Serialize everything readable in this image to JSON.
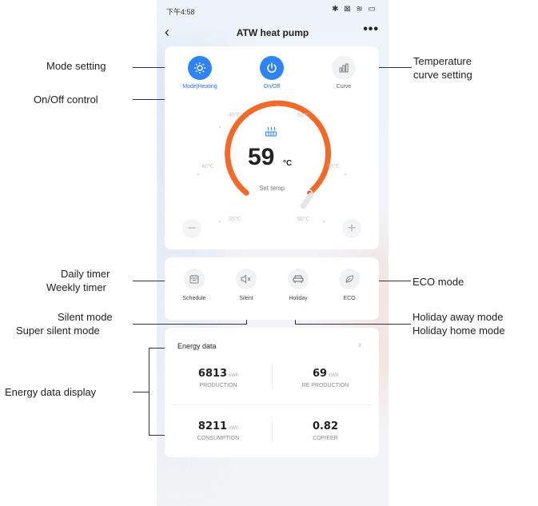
{
  "status_bar": {
    "time": "下午4:58",
    "icons": "✱ ⊠ ≋ ▭"
  },
  "nav": {
    "back_icon": "‹",
    "title": "ATW heat pump",
    "more_icon": "•••"
  },
  "top_controls": [
    {
      "label": "Mode|Heating",
      "icon": "sun-icon",
      "active": true
    },
    {
      "label": "On/Off",
      "icon": "power-icon",
      "active": true
    },
    {
      "label": "Curve",
      "icon": "bar-chart-icon",
      "active": false
    }
  ],
  "dial": {
    "set_value": "59",
    "unit": "°C",
    "caption": "Set temp",
    "ticks": [
      "35℃",
      "40℃",
      "45℃",
      "50℃",
      "55℃",
      "60℃"
    ],
    "arc_color": "#f06a2a",
    "decrease_label": "−",
    "increase_label": "+"
  },
  "mode_buttons": [
    {
      "label": "Schedule",
      "icon": "calendar-icon"
    },
    {
      "label": "Silent",
      "icon": "speaker-mute-icon"
    },
    {
      "label": "Holiday",
      "icon": "sofa-icon"
    },
    {
      "label": "ECO",
      "icon": "leaf-icon"
    }
  ],
  "energy": {
    "title": "Energy data",
    "arrow": "›",
    "cells": [
      {
        "value": "6813",
        "unit": "kWh",
        "label": "PRODUCTION"
      },
      {
        "value": "69",
        "unit": "kWh",
        "label": "RE PRODUCTION"
      },
      {
        "value": "8211",
        "unit": "kWh",
        "label": "CONSUMPTION"
      },
      {
        "value": "0.82",
        "unit": "",
        "label": "COP/EER"
      }
    ]
  },
  "annotations": {
    "mode_setting": "Mode setting",
    "onoff_control": "On/Off control",
    "temp_curve_1": "Temperature",
    "temp_curve_2": "curve setting",
    "daily_timer": "Daily timer",
    "weekly_timer": "Weekly timer",
    "silent_mode": "Silent mode",
    "super_silent_mode": "Super silent mode",
    "energy_display": "Energy data display",
    "eco_mode": "ECO mode",
    "holiday_away": "Holiday away mode",
    "holiday_home": "Holiday home mode"
  },
  "colors": {
    "accent_blue": "#2f84f2",
    "arc_orange": "#f06a2a",
    "line": "#333333"
  }
}
